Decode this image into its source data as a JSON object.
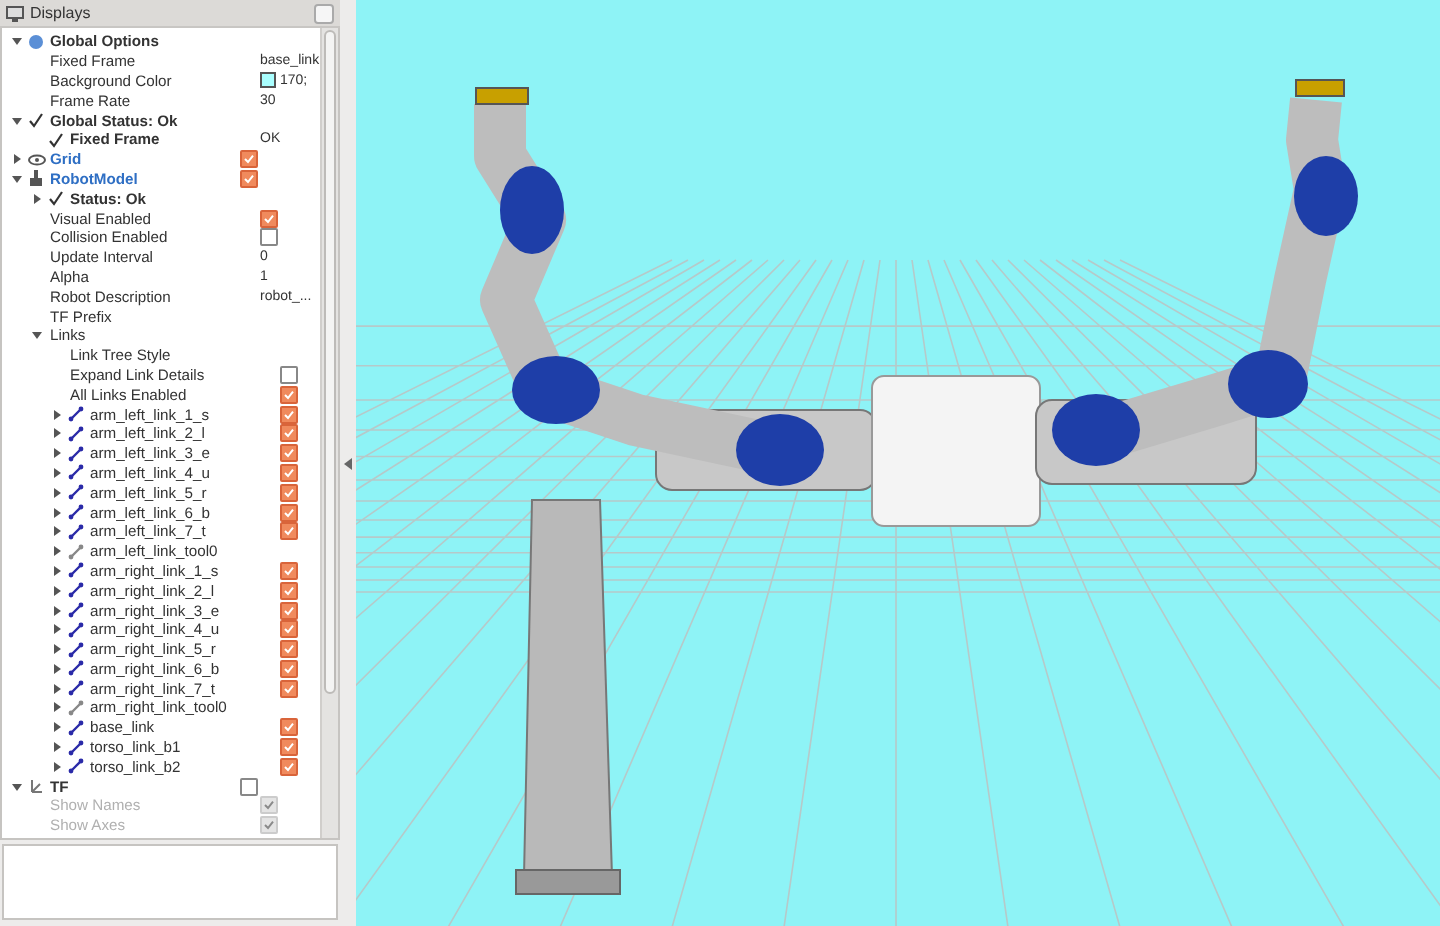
{
  "panel": {
    "title": "Displays"
  },
  "tree": [
    {
      "kind": "options",
      "label": "Global Options",
      "expanded": true,
      "children": [
        {
          "kind": "property",
          "label": "Fixed Frame",
          "value": "base_link"
        },
        {
          "kind": "property",
          "label": "Background Color",
          "value": "170;",
          "color": "#aaffff"
        },
        {
          "kind": "property",
          "label": "Frame Rate",
          "value": "30"
        }
      ]
    },
    {
      "kind": "status",
      "label": "Global Status: Ok",
      "expanded": true,
      "children": [
        {
          "kind": "status",
          "label": "Fixed Frame",
          "value": "OK"
        }
      ]
    },
    {
      "kind": "grid",
      "label": "Grid",
      "expanded": false,
      "checked": true
    },
    {
      "kind": "robot",
      "label": "RobotModel",
      "expanded": true,
      "checked": true,
      "children": [
        {
          "kind": "status",
          "label": "Status: Ok",
          "expanded": false
        },
        {
          "kind": "property",
          "label": "Visual Enabled",
          "checked": true
        },
        {
          "kind": "property",
          "label": "Collision Enabled",
          "checked": false
        },
        {
          "kind": "property",
          "label": "Update Interval",
          "value": "0"
        },
        {
          "kind": "property",
          "label": "Alpha",
          "value": "1"
        },
        {
          "kind": "property",
          "label": "Robot Description",
          "value": "robot_..."
        },
        {
          "kind": "property",
          "label": "TF Prefix"
        },
        {
          "kind": "group",
          "label": "Links",
          "expanded": true,
          "children": [
            {
              "kind": "property",
              "label": "Link Tree Style"
            },
            {
              "kind": "property",
              "label": "Expand Link Details",
              "checked": false
            },
            {
              "kind": "property",
              "label": "All Links Enabled",
              "checked": true
            },
            {
              "kind": "link",
              "label": "arm_left_link_1_s",
              "expanded": false,
              "checked": true
            },
            {
              "kind": "link",
              "label": "arm_left_link_2_l",
              "expanded": false,
              "checked": true
            },
            {
              "kind": "link",
              "label": "arm_left_link_3_e",
              "expanded": false,
              "checked": true
            },
            {
              "kind": "link",
              "label": "arm_left_link_4_u",
              "expanded": false,
              "checked": true
            },
            {
              "kind": "link",
              "label": "arm_left_link_5_r",
              "expanded": false,
              "checked": true
            },
            {
              "kind": "link",
              "label": "arm_left_link_6_b",
              "expanded": false,
              "checked": true
            },
            {
              "kind": "link",
              "label": "arm_left_link_7_t",
              "expanded": false,
              "checked": true
            },
            {
              "kind": "link",
              "label": "arm_left_link_tool0",
              "expanded": false
            },
            {
              "kind": "link",
              "label": "arm_right_link_1_s",
              "expanded": false,
              "checked": true
            },
            {
              "kind": "link",
              "label": "arm_right_link_2_l",
              "expanded": false,
              "checked": true
            },
            {
              "kind": "link",
              "label": "arm_right_link_3_e",
              "expanded": false,
              "checked": true
            },
            {
              "kind": "link",
              "label": "arm_right_link_4_u",
              "expanded": false,
              "checked": true
            },
            {
              "kind": "link",
              "label": "arm_right_link_5_r",
              "expanded": false,
              "checked": true
            },
            {
              "kind": "link",
              "label": "arm_right_link_6_b",
              "expanded": false,
              "checked": true
            },
            {
              "kind": "link",
              "label": "arm_right_link_7_t",
              "expanded": false,
              "checked": true
            },
            {
              "kind": "link",
              "label": "arm_right_link_tool0",
              "expanded": false
            },
            {
              "kind": "link",
              "label": "base_link",
              "expanded": false,
              "checked": true
            },
            {
              "kind": "link",
              "label": "torso_link_b1",
              "expanded": false,
              "checked": true
            },
            {
              "kind": "link",
              "label": "torso_link_b2",
              "expanded": false,
              "checked": true
            }
          ]
        }
      ]
    },
    {
      "kind": "tf",
      "label": "TF",
      "expanded": true,
      "checked": false,
      "children": [
        {
          "kind": "property",
          "label": "Show Names",
          "checked": true,
          "disabled": true
        },
        {
          "kind": "property",
          "label": "Show Axes",
          "checked": true,
          "disabled": true
        }
      ]
    }
  ]
}
